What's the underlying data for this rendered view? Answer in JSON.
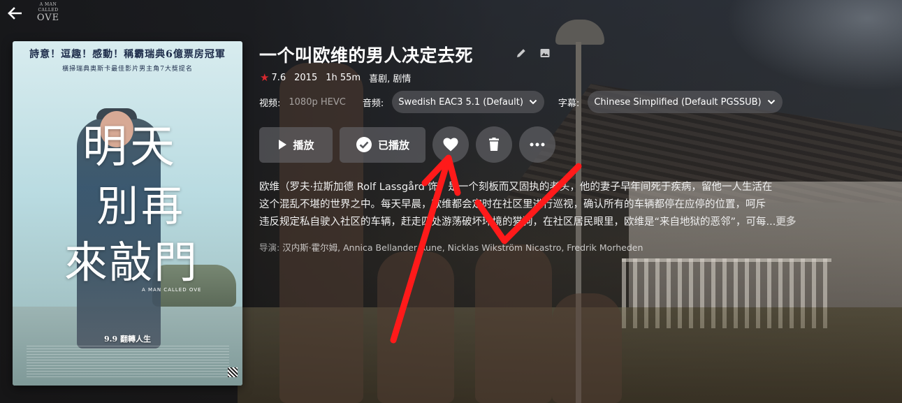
{
  "header": {
    "back_icon": "arrow-left-icon",
    "logo_lines": [
      "A MAN",
      "CALLED",
      "OVE"
    ]
  },
  "poster": {
    "tagline": "詩意！逗趣！感動！稱霸瑞典6億票房冠軍",
    "subline": "橫掃瑞典奧斯卡最佳影片男主角7大獎提名",
    "title_lines": [
      "明天",
      "別再",
      "來敲門"
    ],
    "english_title": "A MAN CALLED OVE",
    "date_line": "9.9 翻轉人生"
  },
  "movie": {
    "title": "一个叫欧维的男人决定去死",
    "rating": "7.6",
    "year": "2015",
    "runtime": "1h 55m",
    "genres": "喜剧, 剧情"
  },
  "streams": {
    "video_label": "视频:",
    "video_value": "1080p HEVC",
    "audio_label": "音频:",
    "audio_value": "Swedish EAC3 5.1 (Default)",
    "subtitle_label": "字幕:",
    "subtitle_value": "Chinese Simplified (Default PGSSUB)"
  },
  "actions": {
    "play_label": "播放",
    "played_label": "已播放"
  },
  "overview": {
    "line1": "欧维（罗夫·拉斯加德 Rolf Lassgård 饰）是一个刻板而又固执的老头，他的妻子早年间死于疾病，留他一人生活在",
    "line2": "这个混乱不堪的世界之中。每天早晨，欧维都会定时在社区里进行巡视，确认所有的车辆都停在应停的位置，呵斥",
    "line3": "违反规定私自驶入社区的车辆，赶走四处游荡破坏环境的猫狗，在社区居民眼里，欧维是“来自地狱的恶邻”，可每...",
    "more_label": "更多"
  },
  "directors": {
    "label": "导演:",
    "names": "汉内斯·霍尔姆, Annica Bellander Rune, Nicklas Wikström Nicastro, Fredrik Morheden"
  },
  "colors": {
    "star": "#d9282f",
    "annotation": "#ff1a1a"
  }
}
